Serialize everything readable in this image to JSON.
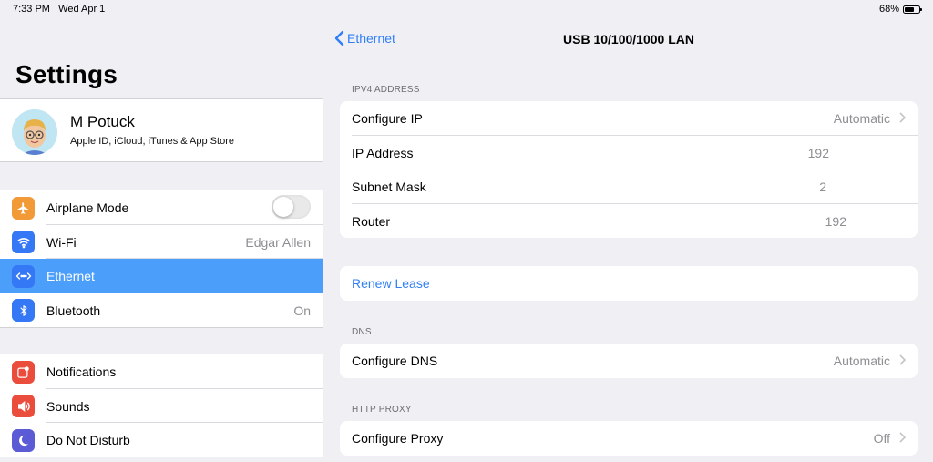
{
  "status": {
    "time": "7:33 PM",
    "date": "Wed Apr 1",
    "battery": "68%",
    "battery_level": 0.68
  },
  "sidebar": {
    "title": "Settings",
    "profile": {
      "name": "M Potuck",
      "subtitle": "Apple ID, iCloud, iTunes & App Store"
    },
    "group1": [
      {
        "label": "Airplane Mode",
        "value": "",
        "icon": "airplane-icon",
        "color": "#f19a37",
        "toggle": false
      },
      {
        "label": "Wi-Fi",
        "value": "Edgar Allen",
        "icon": "wifi-icon",
        "color": "#3478f6"
      },
      {
        "label": "Ethernet",
        "value": "",
        "icon": "ethernet-icon",
        "color": "#3478f6",
        "selected": true
      },
      {
        "label": "Bluetooth",
        "value": "On",
        "icon": "bluetooth-icon",
        "color": "#3478f6"
      }
    ],
    "group2": [
      {
        "label": "Notifications",
        "icon": "notifications-icon",
        "color": "#eb4d3d"
      },
      {
        "label": "Sounds",
        "icon": "sounds-icon",
        "color": "#eb4d3d"
      },
      {
        "label": "Do Not Disturb",
        "icon": "moon-icon",
        "color": "#5b5bd6"
      }
    ]
  },
  "detail": {
    "back_label": "Ethernet",
    "title": "USB 10/100/1000 LAN",
    "ipv4_header": "IPV4 ADDRESS",
    "ipv4_rows": [
      {
        "label": "Configure IP",
        "value": "Automatic"
      },
      {
        "label": "IP Address",
        "value": "192"
      },
      {
        "label": "Subnet Mask",
        "value": "2"
      },
      {
        "label": "Router",
        "value": "192"
      }
    ],
    "renew_label": "Renew Lease",
    "dns_header": "DNS",
    "dns_row": {
      "label": "Configure DNS",
      "value": "Automatic"
    },
    "proxy_header": "HTTP PROXY",
    "proxy_row": {
      "label": "Configure Proxy",
      "value": "Off"
    }
  },
  "colors": {
    "accent": "#2f7ff7",
    "selection": "#4b9ef9"
  }
}
